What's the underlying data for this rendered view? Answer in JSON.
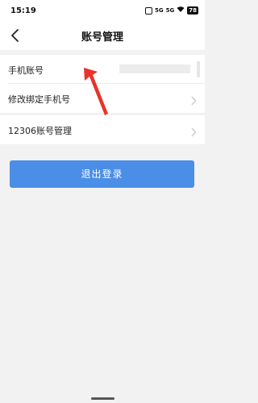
{
  "status_bar": {
    "time": "15:19",
    "signal_1": "5G",
    "signal_2": "5G",
    "battery": "78"
  },
  "header": {
    "title": "账号管理"
  },
  "account": {
    "phone_label": "手机账号",
    "change_phone_label": "修改绑定手机号",
    "manage_12306_label": "12306账号管理"
  },
  "actions": {
    "logout_label": "退出登录"
  },
  "colors": {
    "accent": "#4a8ee8",
    "annotation": "#e8332a"
  },
  "icons": [
    "back-arrow-icon",
    "chevron-right-icon",
    "signal-icon",
    "wifi-icon",
    "battery-icon"
  ]
}
